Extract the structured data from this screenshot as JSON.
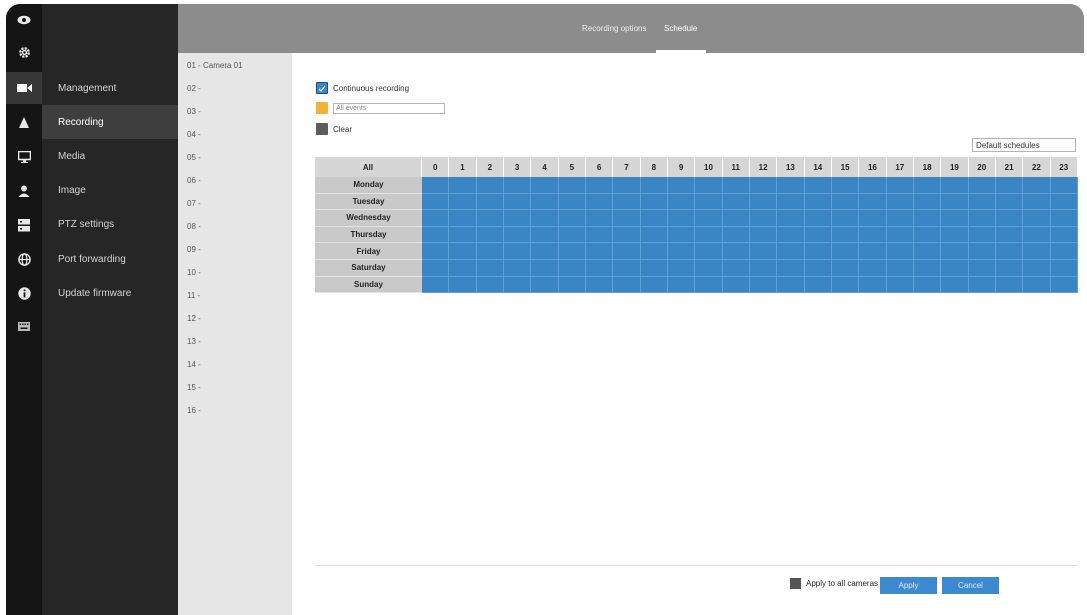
{
  "header": {
    "tabs": [
      {
        "label": "Recording options"
      },
      {
        "label": "Schedule"
      }
    ]
  },
  "menu": {
    "items": [
      {
        "label": "Management",
        "icon": "video-camera-icon"
      },
      {
        "label": "Recording",
        "icon": "bell-icon"
      },
      {
        "label": "Media",
        "icon": "monitor-icon"
      },
      {
        "label": "Image",
        "icon": "user-icon"
      },
      {
        "label": "PTZ settings",
        "icon": "server-icon"
      },
      {
        "label": "Port forwarding",
        "icon": "globe-icon"
      },
      {
        "label": "Update firmware",
        "icon": "info-icon"
      }
    ],
    "active": "Recording"
  },
  "cameras": [
    "01 - Camera 01",
    "02 -",
    "03 -",
    "04 -",
    "05 -",
    "06 -",
    "07 -",
    "08 -",
    "09 -",
    "10 -",
    "11 -",
    "12 -",
    "13 -",
    "14 -",
    "15 -",
    "16 -"
  ],
  "legend": {
    "continuous": "Continuous recording",
    "events_placeholder": "All events",
    "clear": "Clear"
  },
  "default_schedules": "Default schedules",
  "schedule": {
    "all_label": "All",
    "hours": [
      "0",
      "1",
      "2",
      "3",
      "4",
      "5",
      "6",
      "7",
      "8",
      "9",
      "10",
      "11",
      "12",
      "13",
      "14",
      "15",
      "16",
      "17",
      "18",
      "19",
      "20",
      "21",
      "22",
      "23"
    ],
    "days": [
      "Monday",
      "Tuesday",
      "Wednesday",
      "Thursday",
      "Friday",
      "Saturday",
      "Sunday"
    ],
    "mode": "Continuous recording",
    "colors": {
      "continuous": "#3a86c5",
      "events": "#f2b13b",
      "clear": "#5c5c5c"
    }
  },
  "footer": {
    "apply_all_label": "Apply to all cameras",
    "apply_label": "Apply",
    "cancel_label": "Cancel"
  }
}
